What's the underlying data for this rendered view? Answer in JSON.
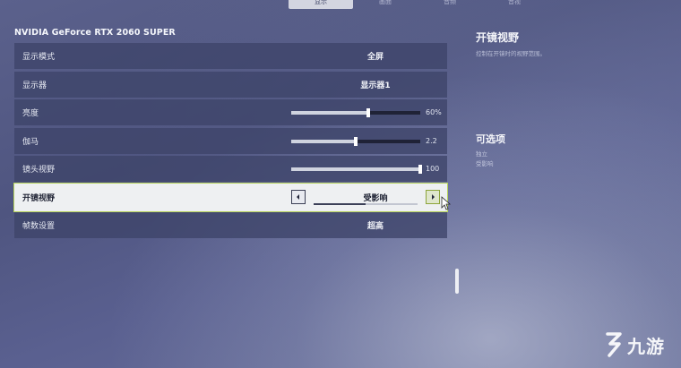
{
  "top_tabs": [
    {
      "label": "显示",
      "active": true
    },
    {
      "label": "画面",
      "active": false
    },
    {
      "label": "音频",
      "active": false
    },
    {
      "label": "音视",
      "active": false
    }
  ],
  "gpu_title": "NVIDIA GeForce RTX 2060 SUPER",
  "settings": {
    "display_mode": {
      "label": "显示模式",
      "value": "全屏"
    },
    "monitor": {
      "label": "显示器",
      "value": "显示器1"
    },
    "brightness": {
      "label": "亮度",
      "value": "60%",
      "level": 0.6
    },
    "gamma": {
      "label": "伽马",
      "value": "2.2",
      "level": 0.5
    },
    "fov": {
      "label": "镜头视野",
      "value": "100",
      "level": 1.0
    },
    "ads_fov": {
      "label": "开镜视野",
      "value": "受影响",
      "prev_icon": "chevron-left-icon",
      "next_icon": "chevron-right-icon",
      "option_index_fraction": 0.5
    },
    "framerate": {
      "label": "帧数设置",
      "value": "超高"
    }
  },
  "info": {
    "title": "开镜视野",
    "description": "控制在开镜时的视野范围。"
  },
  "options": {
    "title": "可选项",
    "items": [
      "独立",
      "受影响"
    ]
  },
  "watermark": {
    "text": "九游",
    "icon": "nine-game-logo-icon"
  },
  "colors": {
    "accent_outline": "#b6d35a",
    "row_bg": "#3e4469",
    "selected_bg": "#eef0f2"
  }
}
